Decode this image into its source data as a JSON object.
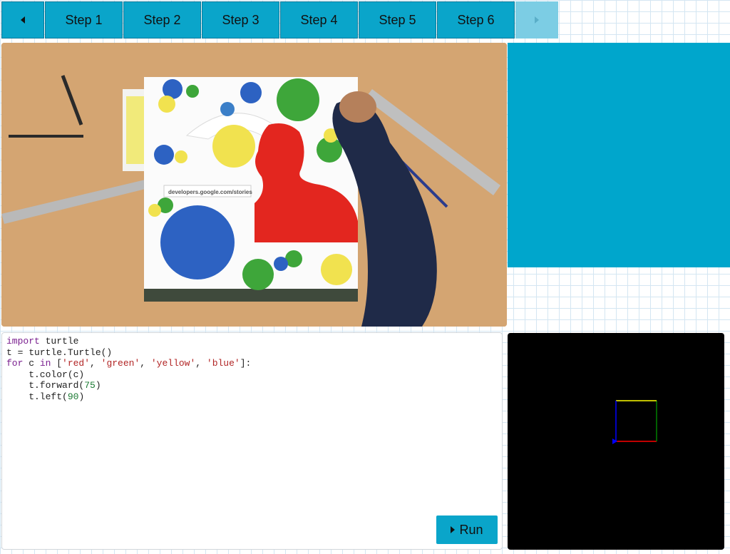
{
  "tabs": {
    "prev_icon": "triangle-left-icon",
    "next_icon": "triangle-right-icon",
    "items": [
      "Step 1",
      "Step 2",
      "Step 3",
      "Step 4",
      "Step 5",
      "Step 6"
    ]
  },
  "video": {
    "url_card_text": "developers.google.com/stories"
  },
  "editor": {
    "code_lines": [
      "import turtle",
      "t = turtle.Turtle()",
      "for c in ['red', 'green', 'yellow', 'blue']:",
      "    t.color(c)",
      "    t.forward(75)",
      "    t.left(90)"
    ],
    "run_label": "Run"
  },
  "turtle_canvas": {
    "colors": [
      "red",
      "green",
      "yellow",
      "blue"
    ],
    "forward": 75,
    "turn": 90
  }
}
